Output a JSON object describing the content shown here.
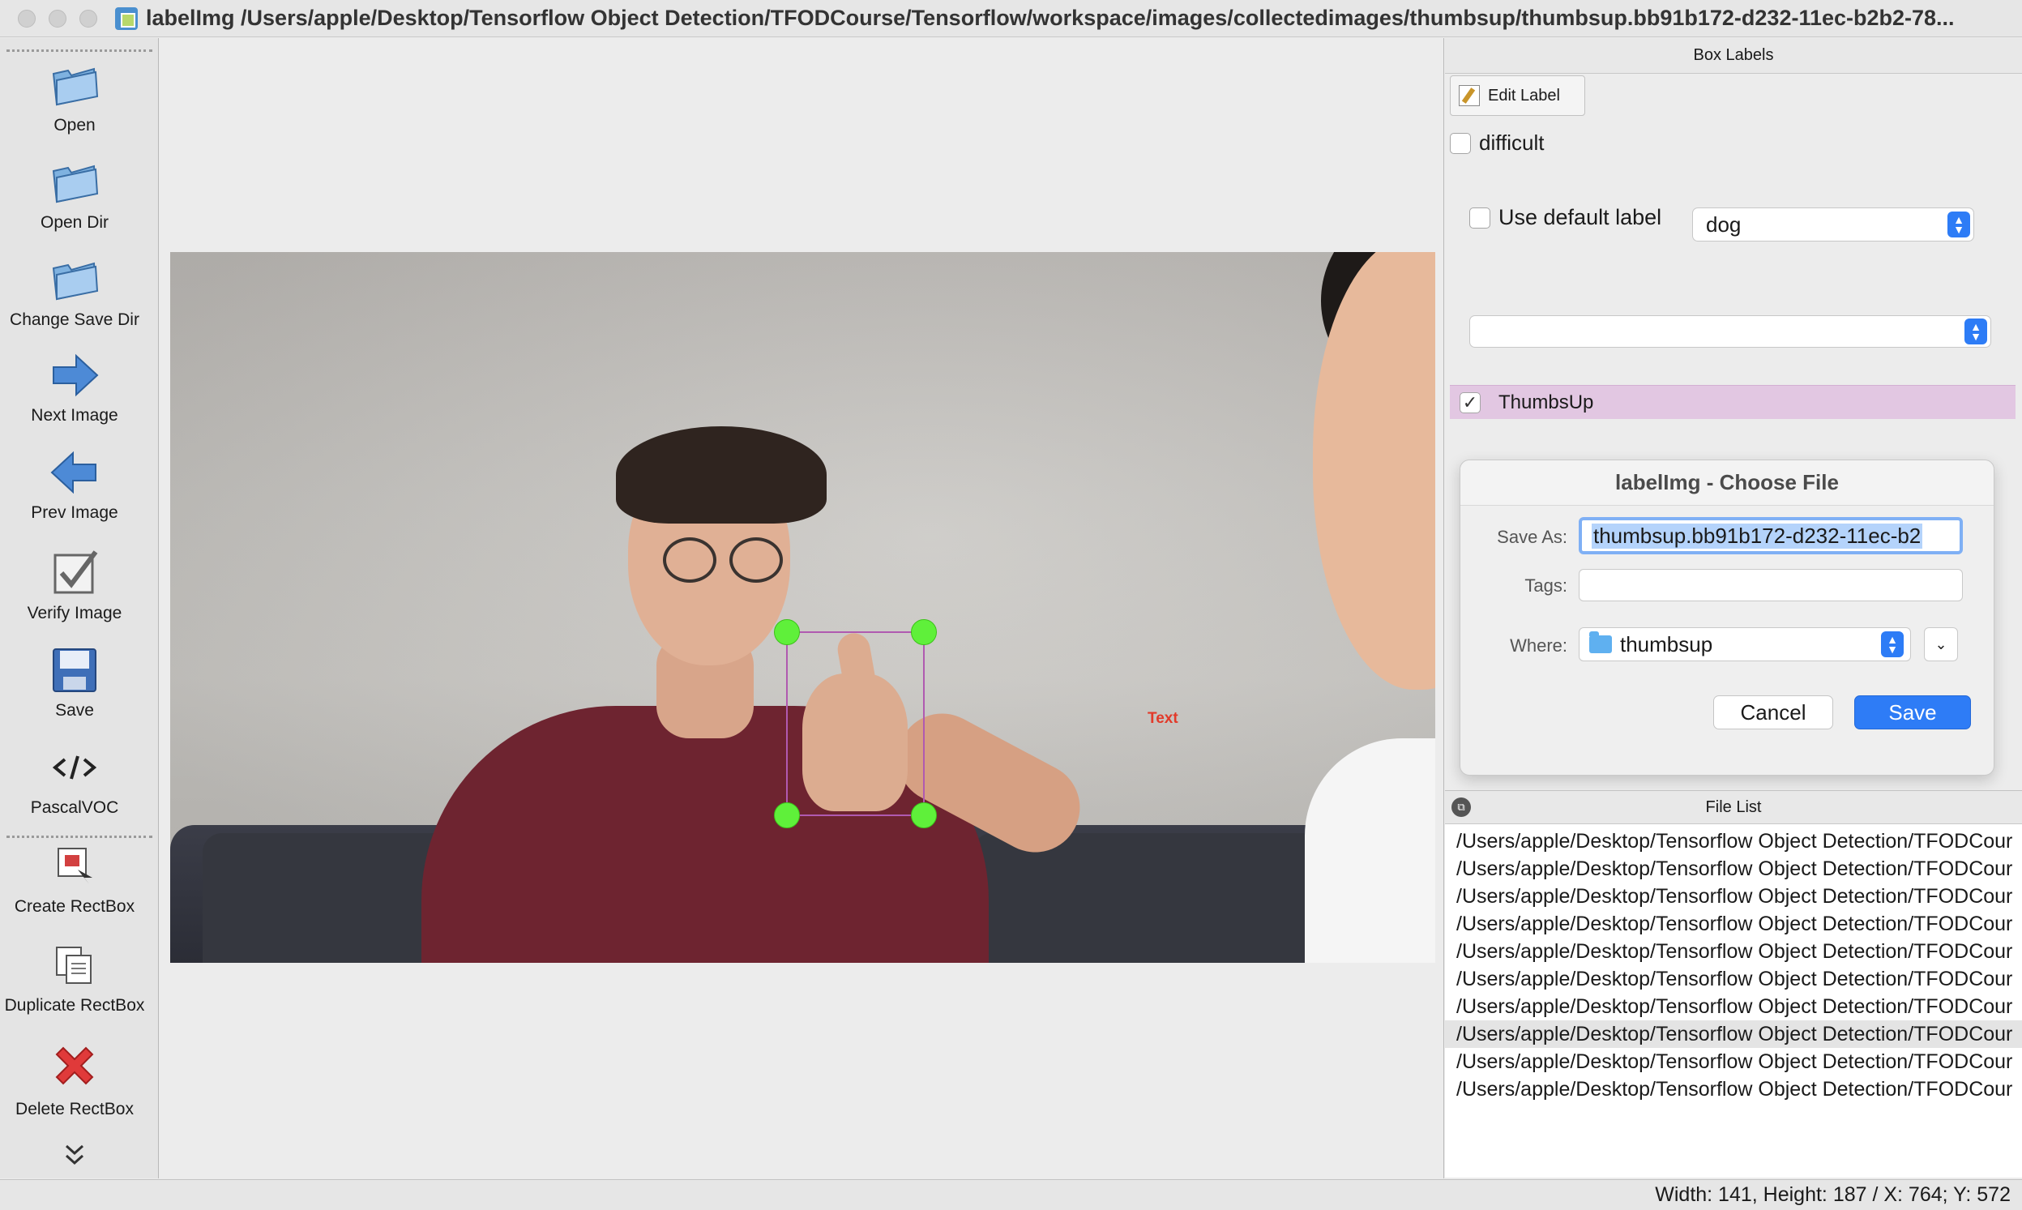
{
  "window": {
    "title": "labelImg /Users/apple/Desktop/Tensorflow Object Detection/TFODCourse/Tensorflow/workspace/images/collectedimages/thumbsup/thumbsup.bb91b172-d232-11ec-b2b2-78..."
  },
  "toolbar": {
    "items": [
      {
        "label": "Open",
        "icon": "folder-open-icon"
      },
      {
        "label": "Open Dir",
        "icon": "folder-open-icon"
      },
      {
        "label": "Change Save Dir",
        "icon": "folder-open-icon"
      },
      {
        "label": "Next Image",
        "icon": "arrow-right-icon"
      },
      {
        "label": "Prev Image",
        "icon": "arrow-left-icon"
      },
      {
        "label": "Verify Image",
        "icon": "checkbox-icon"
      },
      {
        "label": "Save",
        "icon": "floppy-disk-icon"
      },
      {
        "label": "PascalVOC",
        "icon": "code-icon"
      },
      {
        "label": "Create RectBox",
        "icon": "create-rect-icon"
      },
      {
        "label": "Duplicate RectBox",
        "icon": "duplicate-icon"
      },
      {
        "label": "Delete RectBox",
        "icon": "delete-x-icon"
      }
    ],
    "more_icon": "double-chevron-down-icon"
  },
  "canvas": {
    "box_label_text": "Text"
  },
  "box_labels_panel": {
    "title": "Box Labels",
    "edit_label_button": "Edit Label",
    "difficult_label": "difficult",
    "difficult_checked": false,
    "use_default_label": "Use default label",
    "use_default_checked": false,
    "default_label_value": "dog",
    "second_combo_value": "",
    "labels": [
      {
        "name": "ThumbsUp",
        "checked": true,
        "color": "#e2c7e2"
      }
    ]
  },
  "dialog": {
    "title": "labelImg - Choose File",
    "save_as_label": "Save As:",
    "save_as_value": "thumbsup.bb91b172-d232-11ec-b2",
    "tags_label": "Tags:",
    "tags_value": "",
    "where_label": "Where:",
    "where_value": "thumbsup",
    "cancel_label": "Cancel",
    "save_label": "Save",
    "accent_color": "#2e7cf6"
  },
  "file_list_panel": {
    "title": "File List",
    "files": [
      "/Users/apple/Desktop/Tensorflow Object Detection/TFODCour",
      "/Users/apple/Desktop/Tensorflow Object Detection/TFODCour",
      "/Users/apple/Desktop/Tensorflow Object Detection/TFODCour",
      "/Users/apple/Desktop/Tensorflow Object Detection/TFODCour",
      "/Users/apple/Desktop/Tensorflow Object Detection/TFODCour",
      "/Users/apple/Desktop/Tensorflow Object Detection/TFODCour",
      "/Users/apple/Desktop/Tensorflow Object Detection/TFODCour",
      "/Users/apple/Desktop/Tensorflow Object Detection/TFODCour",
      "/Users/apple/Desktop/Tensorflow Object Detection/TFODCour",
      "/Users/apple/Desktop/Tensorflow Object Detection/TFODCour"
    ],
    "selected_index": 7
  },
  "status_bar": {
    "text": "Width: 141, Height: 187 / X: 764; Y: 572"
  }
}
